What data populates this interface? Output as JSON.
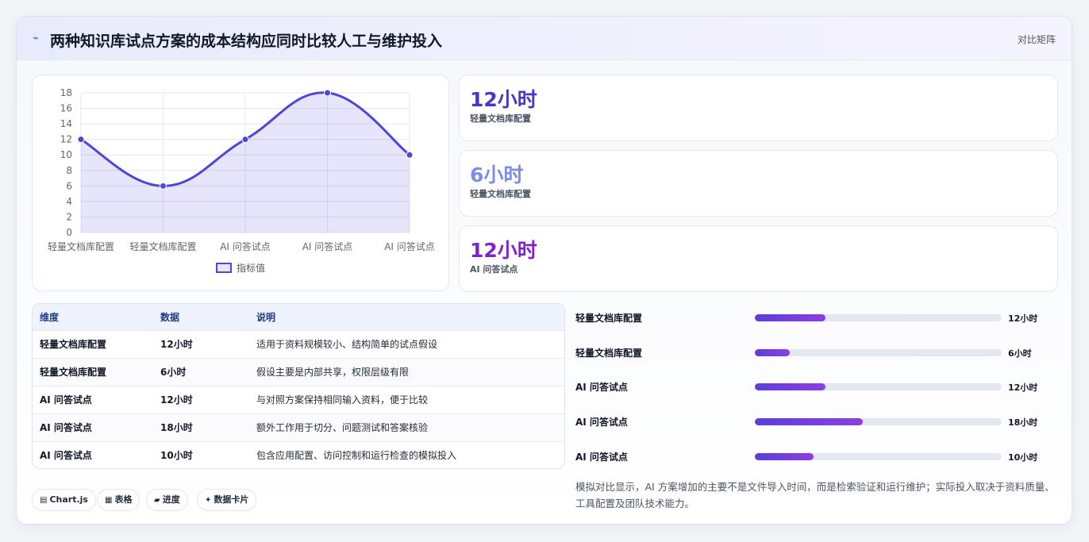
{
  "header": {
    "title": "两种知识库试点方案的成本结构应同时比较人工与维护投入",
    "tag": "对比矩阵",
    "icon": "trend-icon"
  },
  "chart_data": {
    "type": "line",
    "categories": [
      "轻量文档库配置",
      "轻量文档库配置",
      "AI 问答试点",
      "AI 问答试点",
      "AI 问答试点"
    ],
    "series": [
      {
        "name": "指标值",
        "values": [
          12,
          6,
          12,
          18,
          10
        ],
        "color": "#5046d6"
      }
    ],
    "y_ticks": [
      "0",
      "2",
      "4",
      "6",
      "8",
      "10",
      "12",
      "14",
      "16",
      "18"
    ],
    "ylim": [
      0,
      18
    ],
    "grid": true,
    "legend": "bottom"
  },
  "stats": [
    {
      "value": "12小时",
      "label": "轻量文档库配置",
      "color": "#4338ca"
    },
    {
      "value": "6小时",
      "label": "轻量文档库配置",
      "color": "#7c8ce8"
    },
    {
      "value": "12小时",
      "label": "AI 问答试点",
      "color": "#7e22ce"
    }
  ],
  "table": {
    "headers": [
      "维度",
      "数据",
      "说明"
    ],
    "rows": [
      [
        "轻量文档库配置",
        "12小时",
        "适用于资料规模较小、结构简单的试点假设"
      ],
      [
        "轻量文档库配置",
        "6小时",
        "假设主要是内部共享，权限层级有限"
      ],
      [
        "AI 问答试点",
        "12小时",
        "与对照方案保持相同输入资料，便于比较"
      ],
      [
        "AI 问答试点",
        "18小时",
        "额外工作用于切分、问题测试和答案核验"
      ],
      [
        "AI 问答试点",
        "10小时",
        "包含应用配置、访问控制和运行检查的模拟投入"
      ]
    ]
  },
  "progress": [
    {
      "label": "轻量文档库配置",
      "value_text": "12小时",
      "fraction": 0.286
    },
    {
      "label": "轻量文档库配置",
      "value_text": "6小时",
      "fraction": 0.143
    },
    {
      "label": "AI 问答试点",
      "value_text": "12小时",
      "fraction": 0.286
    },
    {
      "label": "AI 问答试点",
      "value_text": "18小时",
      "fraction": 0.436
    },
    {
      "label": "AI 问答试点",
      "value_text": "10小时",
      "fraction": 0.238
    }
  ],
  "note": "模拟对比显示，AI 方案增加的主要不是文件导入时间，而是检索验证和运行维护；实际投入取决于资料质量、工具配置及团队技术能力。",
  "chips": [
    {
      "icon": "▤",
      "label": "Chart.js"
    },
    {
      "icon": "▦",
      "label": "表格"
    },
    {
      "icon": "▰",
      "label": "进度"
    },
    {
      "icon": "✦",
      "label": "数据卡片"
    }
  ]
}
